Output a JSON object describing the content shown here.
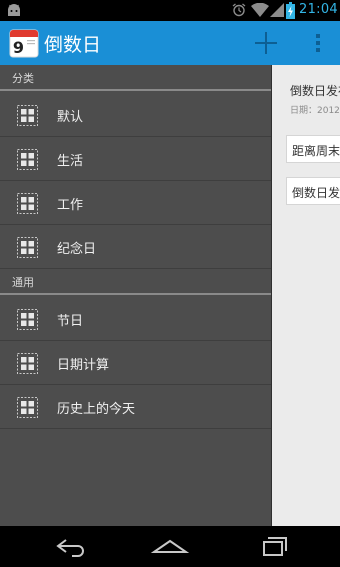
{
  "status_bar": {
    "time": "21:04"
  },
  "app": {
    "icon_day": "9",
    "title": "倒数日"
  },
  "drawer": {
    "section_category": "分类",
    "categories": [
      {
        "label": "默认"
      },
      {
        "label": "生活"
      },
      {
        "label": "工作"
      },
      {
        "label": "纪念日"
      }
    ],
    "section_general": "通用",
    "general": [
      {
        "label": "节日"
      },
      {
        "label": "日期计算"
      },
      {
        "label": "历史上的今天"
      }
    ]
  },
  "content": {
    "title": "倒数日发布",
    "date": "日期：2012",
    "cards": [
      "距离周末还",
      "倒数日发布"
    ]
  },
  "colors": {
    "accent": "#1a8fd6",
    "drawer": "#4d4d4d",
    "time": "#33b5e5"
  }
}
